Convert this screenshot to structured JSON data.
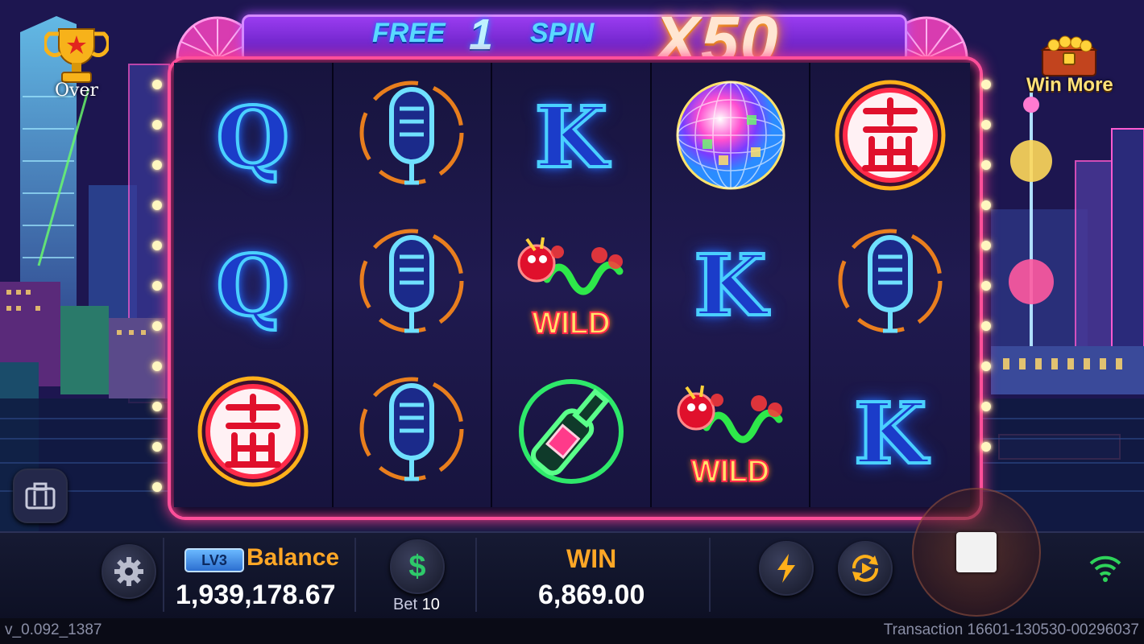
{
  "header": {
    "free_word": "FREE",
    "free_count": "1",
    "spin_word": "SPIN",
    "multiplier": "X50"
  },
  "side": {
    "left_label": "Over",
    "right_label": "Win More"
  },
  "reels": [
    [
      "Q",
      "Q",
      "red-seal-icon"
    ],
    [
      "microphone-icon",
      "microphone-icon",
      "microphone-icon"
    ],
    [
      "K",
      "dragon-wild-icon",
      "beer-bottle-icon"
    ],
    [
      "disco-ball-icon",
      "K",
      "dragon-wild-icon"
    ],
    [
      "red-seal-icon",
      "microphone-icon",
      "K"
    ]
  ],
  "wild_text": "WILD",
  "bottom": {
    "level": "LV3",
    "balance_label": "Balance",
    "balance_value": "1,939,178.67",
    "bet_label": "Bet",
    "bet_value": "10",
    "win_label": "WIN",
    "win_value": "6,869.00",
    "currency_symbol": "$"
  },
  "footer": {
    "version": "v_0.092_1387",
    "transaction": "Transaction 16601-130530-00296037"
  },
  "colors": {
    "frame": "#ff4f9a",
    "balance_label": "#ffa726",
    "win_label": "#ffa726",
    "letter_glow": "#4ad0ff"
  }
}
